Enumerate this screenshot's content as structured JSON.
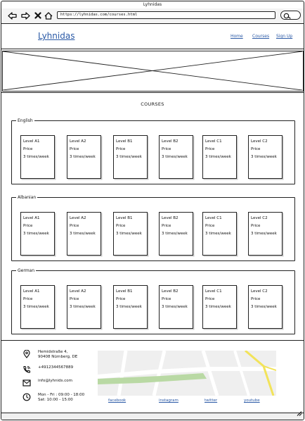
{
  "browser": {
    "window_title": "Lyhnidas",
    "url": "https://lyhnidas.com/courses.html",
    "icons": [
      "back-arrow-icon",
      "forward-arrow-icon",
      "close-x-icon",
      "home-icon",
      "search-icon"
    ]
  },
  "header": {
    "logo": "Lyhnidas",
    "menu": [
      "Home",
      "Courses",
      "Sign Up"
    ]
  },
  "courses": {
    "title": "COURSES",
    "groups": [
      {
        "language": "English",
        "cards": [
          {
            "level": "Level A1",
            "price": "Price",
            "frequency": "3 times/week"
          },
          {
            "level": "Level A2",
            "price": "Price",
            "frequency": "3 times/week"
          },
          {
            "level": "Level B1",
            "price": "Price",
            "frequency": "3 times/week"
          },
          {
            "level": "Level B2",
            "price": "Price",
            "frequency": "3 times/week"
          },
          {
            "level": "Level C1",
            "price": "Price",
            "frequency": "3 times/week"
          },
          {
            "level": "Level C2",
            "price": "Price",
            "frequency": "3 times/week"
          }
        ]
      },
      {
        "language": "Albanian",
        "cards": [
          {
            "level": "Level A1",
            "price": "Price",
            "frequency": "3 times/week"
          },
          {
            "level": "Level A2",
            "price": "Price",
            "frequency": "3 times/week"
          },
          {
            "level": "Level B1",
            "price": "Price",
            "frequency": "3 times/week"
          },
          {
            "level": "Level B2",
            "price": "Price",
            "frequency": "3 times/week"
          },
          {
            "level": "Level C1",
            "price": "Price",
            "frequency": "3 times/week"
          },
          {
            "level": "Level C2",
            "price": "Price",
            "frequency": "3 times/week"
          }
        ]
      },
      {
        "language": "German",
        "cards": [
          {
            "level": "Level A1",
            "price": "Price",
            "frequency": "3 times/week"
          },
          {
            "level": "Level A2",
            "price": "Price",
            "frequency": "3 times/week"
          },
          {
            "level": "Level B1",
            "price": "Price",
            "frequency": "3 times/week"
          },
          {
            "level": "Level B2",
            "price": "Price",
            "frequency": "3 times/week"
          },
          {
            "level": "Level C1",
            "price": "Price",
            "frequency": "3 times/week"
          },
          {
            "level": "Level C2",
            "price": "Price",
            "frequency": "3 times/week"
          }
        ]
      }
    ]
  },
  "footer": {
    "address_line1": "Hemidstraße 4,",
    "address_line2": "90408 Nürnberg, DE",
    "phone": "+4912344567889",
    "email": "info@lyhnids.com",
    "hours_line1": "Mon - Fri : 09:00 - 18:00",
    "hours_line2": "Sat: 10:00 - 15:00",
    "social": [
      "facebook",
      "instagram",
      "twitter",
      "youtube"
    ],
    "icons": [
      "location-pin-icon",
      "phone-icon",
      "mail-icon",
      "clock-icon",
      "map-placeholder"
    ]
  },
  "colors": {
    "link": "#2a59a6",
    "map_road_yellow": "#f2e35a",
    "map_park_green": "#b9d9a4"
  }
}
